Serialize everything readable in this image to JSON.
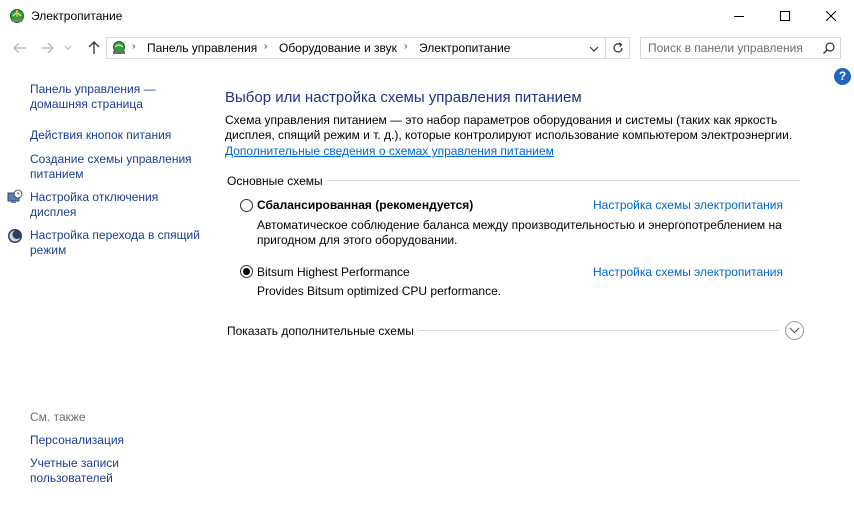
{
  "window": {
    "title": "Электропитание"
  },
  "address": {
    "crumbs": [
      "Панель управления",
      "Оборудование и звук",
      "Электропитание"
    ],
    "separator": "›"
  },
  "search": {
    "placeholder": "Поиск в панели управления"
  },
  "help": {
    "label": "?"
  },
  "sidebar": {
    "home_link": "Панель управления — домашняя страница",
    "links": [
      "Действия кнопок питания",
      "Создание схемы управления питанием",
      "Настройка отключения дисплея",
      "Настройка перехода в спящий режим"
    ],
    "see_also_label": "См. также",
    "see_also_links": [
      "Персонализация",
      "Учетные записи пользователей"
    ]
  },
  "main": {
    "title": "Выбор или настройка схемы управления питанием",
    "description": "Схема управления питанием — это набор параметров оборудования и системы (таких как яркость дисплея, спящий режим и т. д.), которые контролируют использование компьютером электроэнергии.",
    "more_info_link": "Дополнительные сведения о схемах управления питанием",
    "group_header": "Основные схемы",
    "plans": [
      {
        "name": "Сбалансированная (рекомендуется)",
        "link": "Настройка схемы электропитания",
        "description": "Автоматическое соблюдение баланса между производительностью и энергопотреблением на пригодном для этого оборудовании.",
        "selected": false
      },
      {
        "name": "Bitsum Highest Performance",
        "link": "Настройка схемы электропитания",
        "description": "Provides Bitsum optimized CPU performance.",
        "selected": true
      }
    ],
    "show_more": "Показать дополнительные схемы"
  },
  "colors": {
    "link": "#0066cc",
    "sidebar_link": "#1a3d8f",
    "title": "#1e3287",
    "help": "#1f66c2"
  }
}
